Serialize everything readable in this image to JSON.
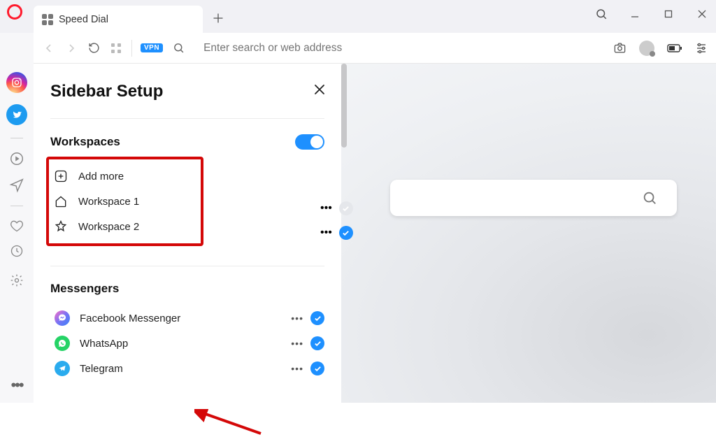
{
  "window": {
    "search_tooltip": "Search"
  },
  "tab": {
    "title": "Speed Dial"
  },
  "addressbar": {
    "vpn_badge": "VPN",
    "placeholder": "Enter search or web address"
  },
  "panel": {
    "title": "Sidebar Setup",
    "sections": {
      "workspaces": {
        "heading": "Workspaces",
        "toggle_on": true,
        "add_label": "Add more",
        "items": [
          {
            "label": "Workspace 1",
            "checked": false
          },
          {
            "label": "Workspace 2",
            "checked": true
          }
        ]
      },
      "messengers": {
        "heading": "Messengers",
        "items": [
          {
            "label": "Facebook Messenger",
            "icon": "fbm",
            "checked": true
          },
          {
            "label": "WhatsApp",
            "icon": "wa",
            "checked": true
          },
          {
            "label": "Telegram",
            "icon": "tg",
            "checked": true
          }
        ]
      }
    }
  }
}
